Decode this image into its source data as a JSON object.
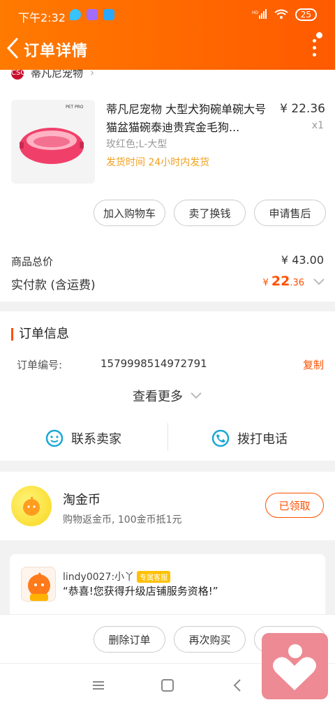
{
  "status_bar": {
    "time": "下午2:32",
    "signal_text": "HD",
    "battery": "25"
  },
  "header": {
    "title": "订单详情"
  },
  "shop": {
    "logo_text": "CSO",
    "name": "蒂凡尼宠物"
  },
  "product": {
    "brand_mark": "PET PRO",
    "title": "蒂凡尼宠物 大型犬狗碗单碗大号猫盆猫碗泰迪贵宾金毛狗...",
    "price": "¥ 22.36",
    "quantity": "x1",
    "variant": "玫红色;L-大型",
    "shipping": "发货时间  24小时内发货"
  },
  "product_actions": {
    "add_cart": "加入购物车",
    "sell": "卖了换钱",
    "after_sale": "申请售后"
  },
  "totals": {
    "goods_total_label": "商品总价",
    "goods_total_value": "¥ 43.00",
    "paid_label": "实付款 (含运费)",
    "paid_currency": "¥",
    "paid_int": "22",
    "paid_dec": ".36"
  },
  "order_info": {
    "section_title": "订单信息",
    "order_no_label": "订单编号:",
    "order_no": "1579998514972791",
    "copy": "复制",
    "see_more": "查看更多",
    "contact_seller": "联系卖家",
    "call": "拨打电话"
  },
  "coins": {
    "title": "淘金币",
    "subtitle": "购物返金币, 100金币抵1元",
    "button": "已领取"
  },
  "service": {
    "name": "lindy0027:小丫",
    "badge": "专属客服",
    "message": "“恭喜!您获得升级店铺服务资格!”"
  },
  "bottom_actions": {
    "delete": "删除订单",
    "rebuy": "再次购买"
  },
  "colors": {
    "accent": "#ff5000",
    "header_start": "#ff7a00",
    "header_end": "#ff5a00",
    "coin": "#f9d61b",
    "fab": "#ee8a94"
  }
}
